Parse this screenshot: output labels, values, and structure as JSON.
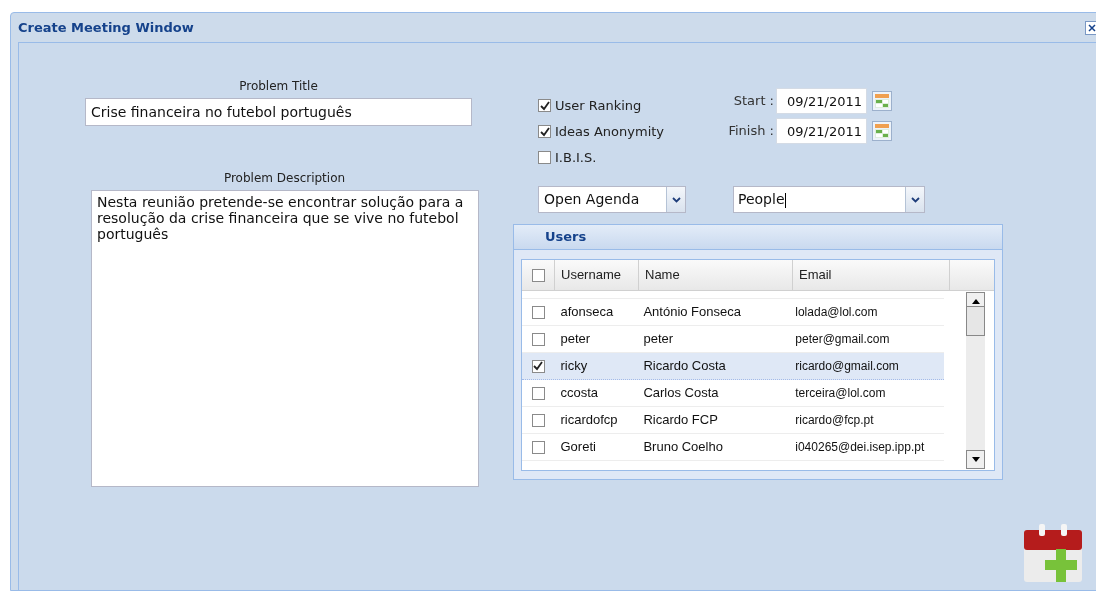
{
  "window": {
    "title": "Create Meeting Window"
  },
  "problem_title": {
    "label": "Problem Title",
    "value": "Crise financeira no futebol português"
  },
  "problem_description": {
    "label": "Problem Description",
    "value": "Nesta reunião pretende-se encontrar solução para a resolução da crise financeira que se vive no futebol português"
  },
  "options": [
    {
      "label": "User Ranking",
      "checked": true
    },
    {
      "label": "Ideas Anonymity",
      "checked": true
    },
    {
      "label": "I.B.I.S.",
      "checked": false
    }
  ],
  "dates": [
    {
      "label": "Start :",
      "value": "09/21/2011"
    },
    {
      "label": "Finish :",
      "value": "09/21/2011"
    }
  ],
  "agenda_combo": {
    "value": "Open Agenda"
  },
  "people_combo": {
    "value": "People"
  },
  "users": {
    "title": "Users",
    "all_checked": false,
    "columns": [
      "Username",
      "Name",
      "Email"
    ],
    "rows": [
      {
        "username": "afonseca",
        "name": "António Fonseca",
        "email": "lolada@lol.com",
        "selected": false
      },
      {
        "username": "peter",
        "name": "peter",
        "email": "peter@gmail.com",
        "selected": false
      },
      {
        "username": "ricky",
        "name": "Ricardo Costa",
        "email": "ricardo@gmail.com",
        "selected": true
      },
      {
        "username": "ccosta",
        "name": "Carlos Costa",
        "email": "terceira@lol.com",
        "selected": false
      },
      {
        "username": "ricardofcp",
        "name": "Ricardo FCP",
        "email": "ricardo@fcp.pt",
        "selected": false
      },
      {
        "username": "Goreti",
        "name": "Bruno Coelho",
        "email": "i040265@dei.isep.ipp.pt",
        "selected": false
      }
    ]
  }
}
